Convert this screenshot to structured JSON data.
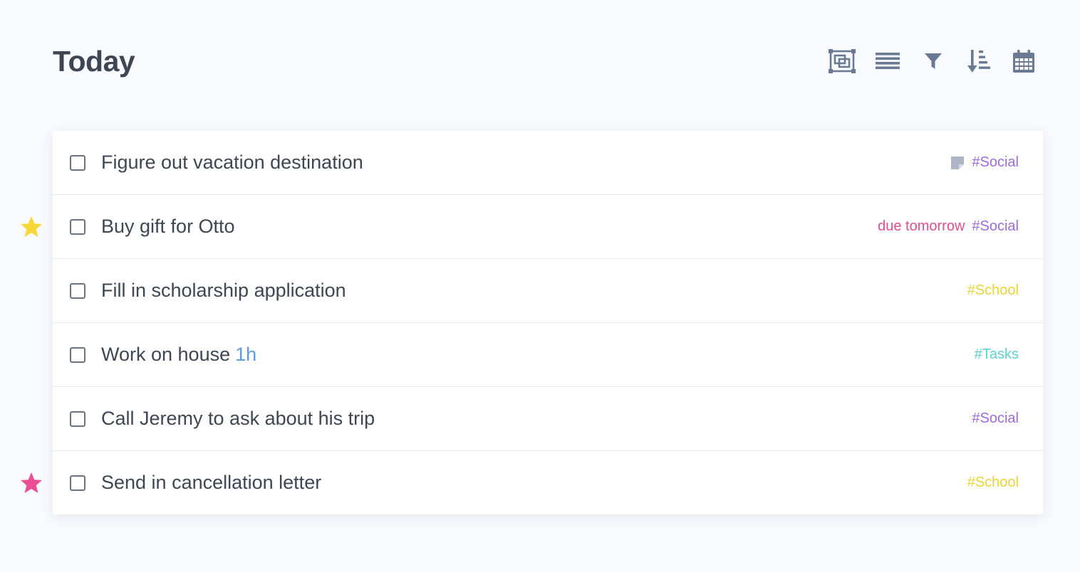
{
  "page": {
    "title": "Today"
  },
  "toolbar": {
    "icons": [
      "focus-icon",
      "list-view-icon",
      "filter-icon",
      "sort-icon",
      "calendar-icon"
    ],
    "icon_color": "#6b7a93"
  },
  "colors": {
    "background": "#f8fafe",
    "text": "#3f4653",
    "tag_social": "#9b6ddb",
    "tag_school": "#ead437",
    "tag_tasks": "#5fd1d1",
    "due": "#e04f8d",
    "duration": "#5a9de6",
    "star_yellow": "#f8d739",
    "star_pink": "#ea4f96"
  },
  "tasks": [
    {
      "title": "Figure out vacation destination",
      "duration": "",
      "due": "",
      "tag": "#Social",
      "has_note": true,
      "star": ""
    },
    {
      "title": "Buy gift for Otto",
      "duration": "",
      "due": "due tomorrow",
      "tag": "#Social",
      "has_note": false,
      "star": "yellow"
    },
    {
      "title": "Fill in scholarship application",
      "duration": "",
      "due": "",
      "tag": "#School",
      "has_note": false,
      "star": ""
    },
    {
      "title": "Work on house",
      "duration": "1h",
      "due": "",
      "tag": "#Tasks",
      "has_note": false,
      "star": ""
    },
    {
      "title": "Call Jeremy to ask about his trip",
      "duration": "",
      "due": "",
      "tag": "#Social",
      "has_note": false,
      "star": ""
    },
    {
      "title": "Send in cancellation letter",
      "duration": "",
      "due": "",
      "tag": "#School",
      "has_note": false,
      "star": "pink"
    }
  ]
}
